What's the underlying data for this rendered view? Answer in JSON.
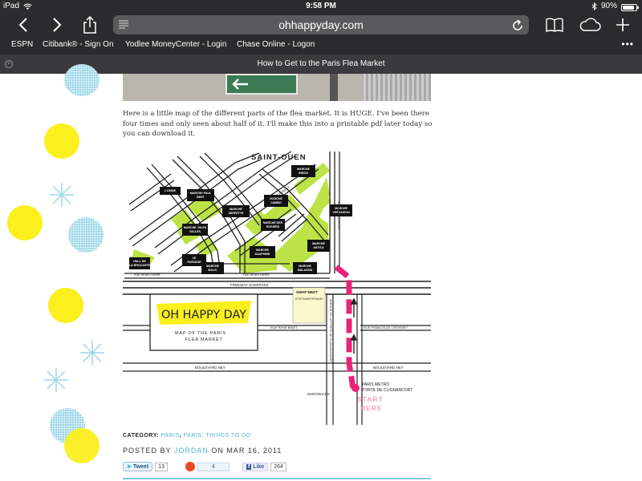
{
  "status_bar": {
    "device": "iPad",
    "time": "9:58 PM",
    "battery": "90%",
    "battery_level": 0.9
  },
  "toolbar": {
    "url": "ohhappyday.com",
    "icons": [
      "back-icon",
      "forward-icon",
      "share-icon",
      "reader-icon",
      "reload-icon",
      "bookmarks-icon",
      "icloud-tabs-icon",
      "new-tab-icon"
    ]
  },
  "bookmarks": [
    "ESPN",
    "Citibank® - Sign On",
    "Yodlee MoneyCenter - Login",
    "Chase Online - Logon"
  ],
  "tab": {
    "title": "How to Get to the Paris Flea Market"
  },
  "article": {
    "intro": "Here is a little map of the different parts of the flea market. It is HUGE. I've been there four times and only seen about half of it. I'll make this into a printable pdf later today so you can download it.",
    "map": {
      "district": "SAINT-OUEN",
      "markets": [
        "L'USINE",
        "MARCHE PAUL BERT",
        "MARCHE SERPETTE",
        "MARCHE CAMBO",
        "MARCHE BIRON",
        "MARCHE VERNAISON",
        "MARCHE JULES VALLES",
        "MARCHE DES ROSIERS",
        "LE PASSAGE",
        "MARCHE ANTICA",
        "HALL DE LA BROCANTE",
        "MARCHE MALIC",
        "MARCHE DAUPHINE",
        "MARCHE MALASSIS"
      ],
      "streets": {
        "henri_farre_1": "RUE HENRI-FARRE",
        "henri_farre_2": "RUE HENRI-FARRE",
        "freeway": "FREEWAY OVERPASS",
        "rene_binet": "RUE RENE BINET",
        "francis_croisset": "RUE FRANCIS DE CROISSET",
        "boulevard_1": "BOULEVARD NEY",
        "boulevard_2": "BOULEVARD NEY",
        "avenue": "AVENUE DE LA PORTE DE CLIGNANCOURT",
        "avenue_michelet": "AVENUE MICHELET",
        "rosiers": "RUE DES ROSIERS"
      },
      "swap_meet_title": "SWAP MEET",
      "swap_meet_note": "NOT THE FLEA MARKET KEEP WALKING!",
      "logo_text": "OH HAPPY DAY",
      "map_title_1": "MAP OF THE PARIS",
      "map_title_2": "FLEA MARKET",
      "mcdonalds": "McDONALDS",
      "metro_1": "PARIS METRO",
      "metro_2": "PORTE DE CLIGNANCORT",
      "start_1": "START",
      "start_2": "HERE",
      "colors": {
        "market": "#bde246",
        "route": "#e8247a",
        "start": "#f4a3c6",
        "logo_bg": "#fbef1e"
      }
    },
    "category_label": "CATEGORY:",
    "categories": [
      "PARIS",
      "PARIS: THINGS TO DO"
    ],
    "posted_by": "POSTED BY",
    "author": "JORDAN",
    "posted_on": "ON MAR 16, 2011",
    "social": {
      "tweet_label": "Tweet",
      "tweet_count": "13",
      "stumble_count": "4",
      "like_label": "Like",
      "like_count": "264"
    }
  }
}
